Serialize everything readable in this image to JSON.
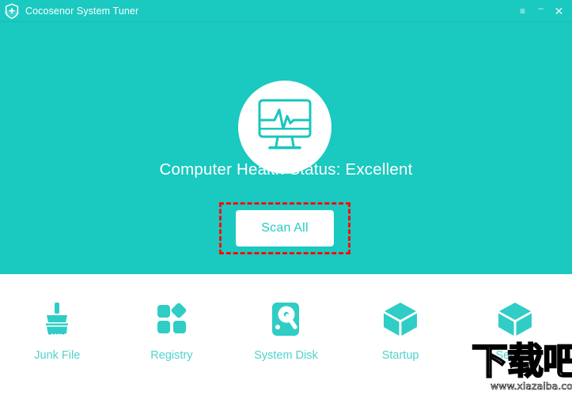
{
  "window": {
    "title": "Cocosenor System Tuner",
    "logo_icon": "shield-plus-icon",
    "controls": {
      "menu_icon": "hamburger-menu-icon",
      "menu_glyph": "≡",
      "minimize_icon": "minimize-icon",
      "minimize_glyph": "–",
      "close_icon": "close-icon",
      "close_glyph": "✕"
    }
  },
  "hero": {
    "health_icon": "monitor-heartbeat-icon",
    "health_status": "Computer Health Status: Excellent",
    "scan_button_label": "Scan All",
    "highlight_color": "#fb0d0d"
  },
  "tools": [
    {
      "label": "Junk File",
      "icon": "broom-icon"
    },
    {
      "label": "Registry",
      "icon": "registry-blocks-icon"
    },
    {
      "label": "System Disk",
      "icon": "hard-disk-icon"
    },
    {
      "label": "Startup",
      "icon": "cube-icon"
    },
    {
      "label": "Service",
      "icon": "cube-icon"
    }
  ],
  "watermark": {
    "text": "下载吧",
    "url": "www.xiazaiba.com"
  },
  "colors": {
    "teal": "#1ac9c0",
    "teal_label": "#4fd3cd",
    "button_text": "#23cdc4",
    "annotation_red": "#fb0d0d",
    "white": "#ffffff"
  }
}
